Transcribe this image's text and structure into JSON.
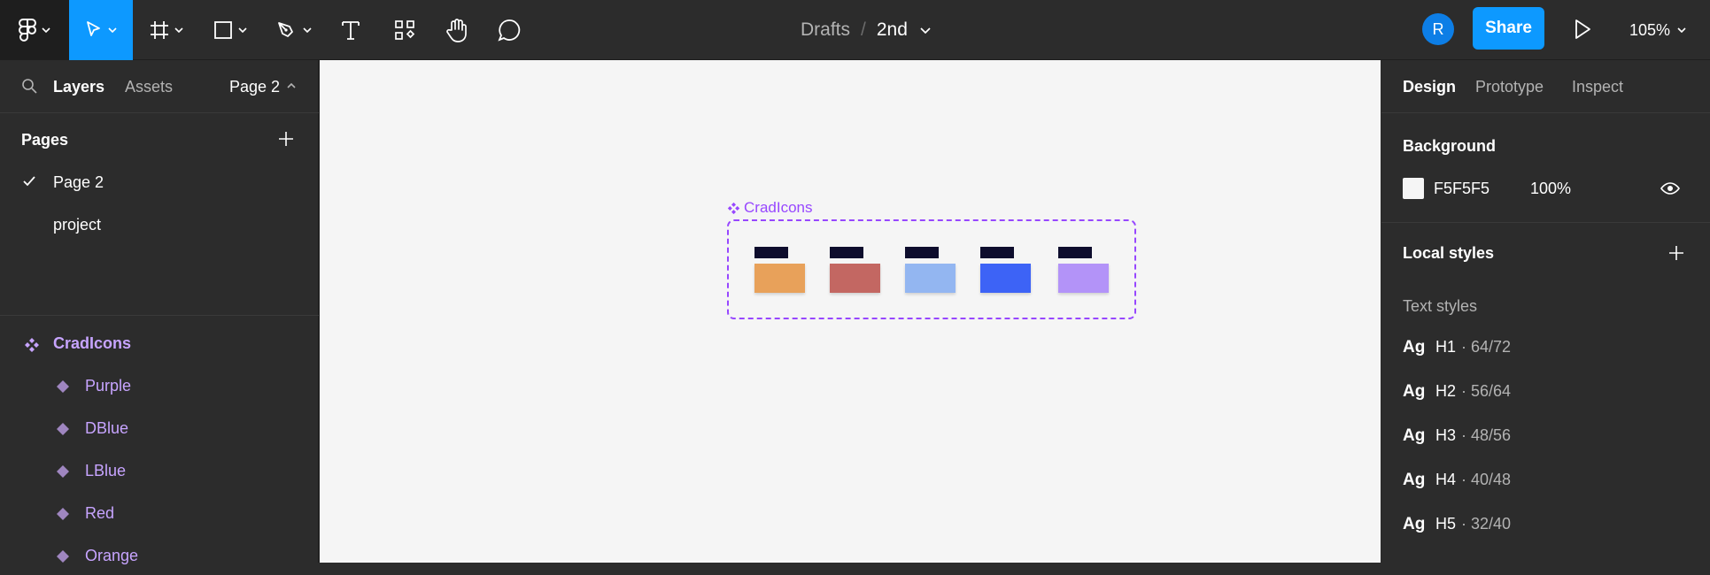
{
  "toolbar": {
    "breadcrumb_parent": "Drafts",
    "breadcrumb_sep": "/",
    "file_name": "2nd",
    "avatar_initial": "R",
    "share_label": "Share",
    "zoom": "105%"
  },
  "left_panel": {
    "tabs": [
      "Layers",
      "Assets"
    ],
    "page_selector": "Page 2",
    "pages_heading": "Pages",
    "pages": [
      {
        "label": "Page 2",
        "selected": true
      },
      {
        "label": "project",
        "selected": false
      }
    ],
    "layers": [
      {
        "label": "CradIcons",
        "type": "component-set"
      },
      {
        "label": "Purple",
        "type": "component"
      },
      {
        "label": "DBlue",
        "type": "component"
      },
      {
        "label": "LBlue",
        "type": "component"
      },
      {
        "label": "Red",
        "type": "component"
      },
      {
        "label": "Orange",
        "type": "component"
      }
    ]
  },
  "canvas": {
    "background": "#F5F5F5",
    "frame_label": "CradIcons",
    "frame_color": "#9747FF",
    "swatches": [
      {
        "name": "Orange",
        "color": "#E8A15A"
      },
      {
        "name": "Red",
        "color": "#C36762"
      },
      {
        "name": "LBlue",
        "color": "#93B6F1"
      },
      {
        "name": "DBlue",
        "color": "#3D63F6"
      },
      {
        "name": "Purple",
        "color": "#B393F8"
      }
    ]
  },
  "right_panel": {
    "tabs": [
      "Design",
      "Prototype",
      "Inspect"
    ],
    "background_heading": "Background",
    "background_hex": "F5F5F5",
    "background_opacity": "100%",
    "local_styles_heading": "Local styles",
    "text_styles_heading": "Text styles",
    "text_styles": [
      {
        "sample": "Ag",
        "name": "H1",
        "size": "· 64/72"
      },
      {
        "sample": "Ag",
        "name": "H2",
        "size": "· 56/64"
      },
      {
        "sample": "Ag",
        "name": "H3",
        "size": "· 48/56"
      },
      {
        "sample": "Ag",
        "name": "H4",
        "size": "· 40/48"
      },
      {
        "sample": "Ag",
        "name": "H5",
        "size": "· 32/40"
      }
    ]
  }
}
